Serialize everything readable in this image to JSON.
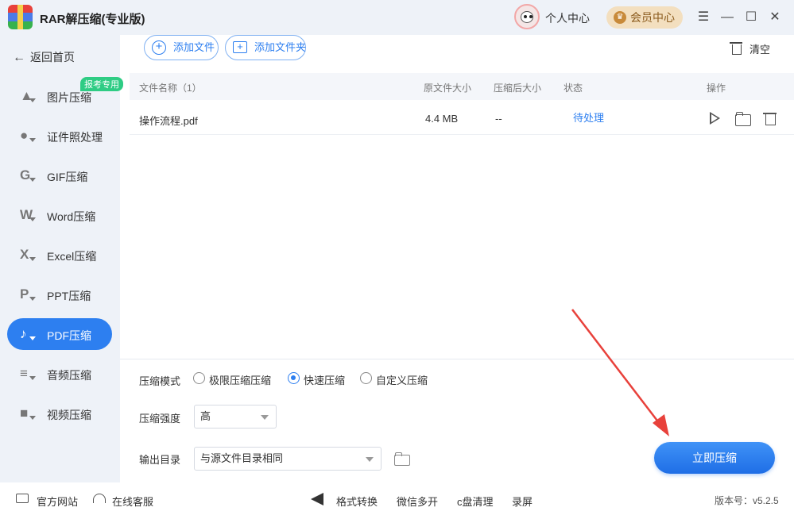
{
  "app": {
    "title": "RAR解压缩(专业版)"
  },
  "header": {
    "personal_center": "个人中心",
    "vip_center": "会员中心"
  },
  "sidebar": {
    "back_label": "返回首页",
    "badge": "报考专用",
    "items": [
      {
        "label": "图片压缩",
        "icon": "image-compress-icon",
        "glyph": "▲"
      },
      {
        "label": "证件照处理",
        "icon": "id-photo-icon",
        "glyph": "●"
      },
      {
        "label": "GIF压缩",
        "icon": "gif-icon",
        "glyph": "G"
      },
      {
        "label": "Word压缩",
        "icon": "word-icon",
        "glyph": "W"
      },
      {
        "label": "Excel压缩",
        "icon": "excel-icon",
        "glyph": "X"
      },
      {
        "label": "PPT压缩",
        "icon": "ppt-icon",
        "glyph": "P"
      },
      {
        "label": "PDF压缩",
        "icon": "pdf-icon",
        "glyph": "♪"
      },
      {
        "label": "音频压缩",
        "icon": "audio-icon",
        "glyph": "≡"
      },
      {
        "label": "视频压缩",
        "icon": "video-icon",
        "glyph": "■"
      }
    ],
    "active_index": 6
  },
  "toolbar": {
    "add_file": "添加文件",
    "add_folder": "添加文件夹",
    "clear": "清空"
  },
  "table": {
    "headers": {
      "name": "文件名称（1）",
      "original_size": "原文件大小",
      "compressed_size": "压缩后大小",
      "status": "状态",
      "actions": "操作"
    },
    "rows": [
      {
        "name": "操作流程.pdf",
        "original_size": "4.4 MB",
        "compressed_size": "--",
        "status": "待处理"
      }
    ]
  },
  "settings": {
    "mode_label": "压缩模式",
    "modes": [
      "极限压缩压缩",
      "快速压缩",
      "自定义压缩"
    ],
    "selected_mode": "快速压缩",
    "strength_label": "压缩强度",
    "strength_value": "高",
    "output_label": "输出目录",
    "output_value": "与源文件目录相同",
    "start_button": "立即压缩"
  },
  "footer": {
    "website": "官方网站",
    "support": "在线客服",
    "links": [
      "格式转换",
      "微信多开",
      "c盘清理",
      "录屏"
    ],
    "version": "版本号：v5.2.5"
  },
  "colors": {
    "accent": "#2d7ff0",
    "badge": "#2ecc84",
    "vip": "#f3dfbf",
    "annotation": "#e8413b"
  }
}
